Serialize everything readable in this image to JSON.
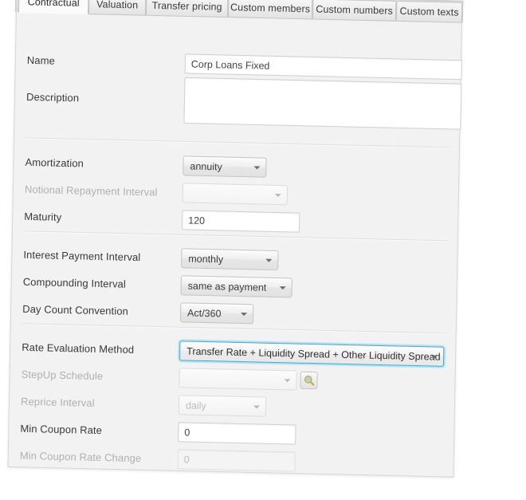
{
  "window": {
    "background_color": "#ffffff",
    "panel_color": "#f2f2f2",
    "accent_focus_color": "#3fa9d4"
  },
  "tabs": [
    {
      "label": "Contractual",
      "active": true
    },
    {
      "label": "Valuation",
      "active": false
    },
    {
      "label": "Transfer pricing",
      "active": false
    },
    {
      "label": "Custom members",
      "active": false
    },
    {
      "label": "Custom numbers",
      "active": false
    },
    {
      "label": "Custom texts",
      "active": false
    }
  ],
  "form": {
    "name": {
      "label": "Name",
      "value": "Corp Loans Fixed",
      "placeholder": ""
    },
    "description": {
      "label": "Description",
      "value": "",
      "placeholder": ""
    },
    "amortization": {
      "label": "Amortization",
      "value": "annuity",
      "enabled": true
    },
    "notional_repayment_interval": {
      "label": "Notional Repayment Interval",
      "value": "",
      "enabled": false
    },
    "maturity": {
      "label": "Maturity",
      "value": "120",
      "enabled": true
    },
    "interest_payment_interval": {
      "label": "Interest Payment Interval",
      "value": "monthly",
      "enabled": true
    },
    "compounding_interval": {
      "label": "Compounding Interval",
      "value": "same as payment",
      "enabled": true
    },
    "day_count_convention": {
      "label": "Day Count Convention",
      "value": "Act/360",
      "enabled": true
    },
    "rate_evaluation_method": {
      "label": "Rate Evaluation Method",
      "value": "Transfer Rate + Liquidity Spread + Other Liquidity Spread",
      "enabled": true,
      "focused": true
    },
    "stepup_schedule": {
      "label": "StepUp Schedule",
      "value": "",
      "enabled": false,
      "browse_icon": "magnifier-icon"
    },
    "reprice_interval": {
      "label": "Reprice Interval",
      "value": "daily",
      "enabled": false
    },
    "min_coupon_rate": {
      "label": "Min Coupon Rate",
      "value": "0",
      "enabled": true
    },
    "min_coupon_rate_change": {
      "label": "Min Coupon Rate Change",
      "value": "0",
      "enabled": false
    }
  }
}
